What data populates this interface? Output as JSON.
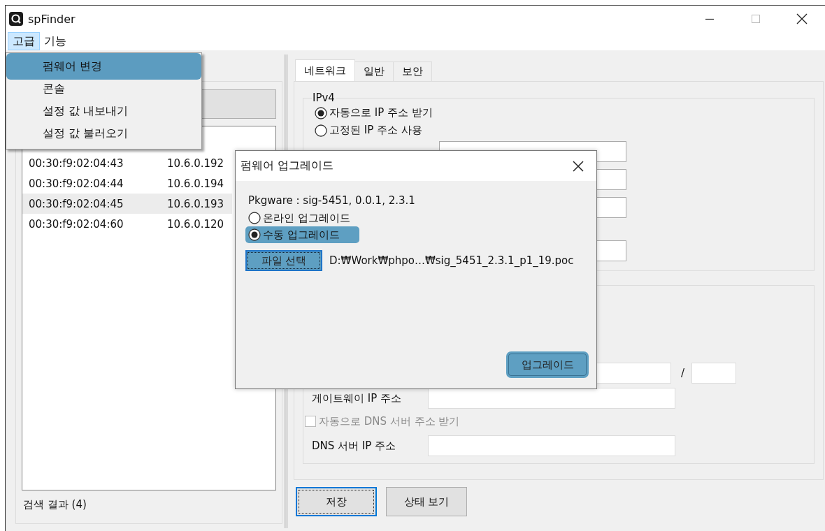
{
  "window": {
    "title": "spFinder"
  },
  "menubar": [
    {
      "label": "고급",
      "selected": true
    },
    {
      "label": "기능",
      "selected": false
    }
  ],
  "menu": [
    {
      "label": "펌웨어 변경",
      "selected": true
    },
    {
      "label": "콘솔",
      "selected": false
    },
    {
      "label": "설정 값 내보내기",
      "selected": false
    },
    {
      "label": "설정 값 불러오기",
      "selected": false
    }
  ],
  "device_list": {
    "rows": [
      {
        "mac": "00:30:f9:02:04:43",
        "ip": "10.6.0.192",
        "selected": false
      },
      {
        "mac": "00:30:f9:02:04:44",
        "ip": "10.6.0.194",
        "selected": false
      },
      {
        "mac": "00:30:f9:02:04:45",
        "ip": "10.6.0.193",
        "selected": true
      },
      {
        "mac": "00:30:f9:02:04:60",
        "ip": "10.6.0.120",
        "selected": false
      }
    ],
    "result_label": "검색 결과 (4)"
  },
  "tabs": [
    {
      "label": "네트워크",
      "selected": true
    },
    {
      "label": "일반",
      "selected": false
    },
    {
      "label": "보안",
      "selected": false
    }
  ],
  "ipv4": {
    "legend": "IPv4",
    "options": [
      {
        "label": "자동으로 IP 주소 받기",
        "selected": true
      },
      {
        "label": "고정된 IP 주소 사용",
        "selected": false
      }
    ]
  },
  "group_2": {
    "separator": "/",
    "gateway_label": "게이트웨이 IP 주소",
    "dns_auto": {
      "label": "자동으로 DNS 서버 주소 받기",
      "checked": false,
      "disabled": true
    },
    "dns_label": "DNS 서버 IP 주소"
  },
  "buttons": [
    {
      "label": "저장",
      "focused": true
    },
    {
      "label": "상태 보기",
      "focused": false
    }
  ],
  "dialog": {
    "title": "펌웨어 업그레이드",
    "info": "Pkgware : sig-5451, 0.0.1, 2.3.1",
    "options": [
      {
        "label": "온라인 업그레이드",
        "selected": false,
        "highlighted": false
      },
      {
        "label": "수동 업그레이드",
        "selected": true,
        "highlighted": true
      }
    ],
    "file_button": {
      "label": "파일 선택",
      "highlighted": true
    },
    "file_path": "D:₩Work₩phpo…₩sig_5451_2.3.1_p1_19.poc",
    "upgrade_button": {
      "label": "업그레이드",
      "highlighted": true
    }
  }
}
